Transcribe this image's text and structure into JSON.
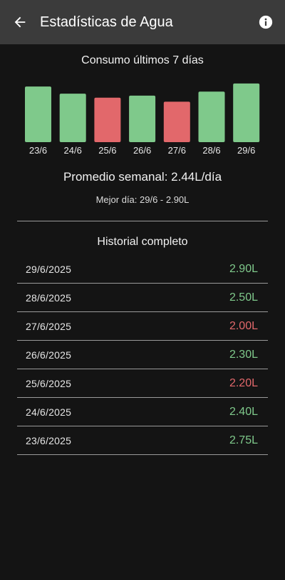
{
  "appbar": {
    "title": "Estadísticas de Agua",
    "back_icon": "arrow-left-icon",
    "info_icon": "info-icon"
  },
  "colors": {
    "good": "#7fc98b",
    "bad": "#e2686b",
    "appbar": "#3b3b3b",
    "background": "#141414"
  },
  "chart": {
    "title": "Consumo últimos 7 días"
  },
  "chart_data": {
    "type": "bar",
    "categories": [
      "23/6",
      "24/6",
      "25/6",
      "26/6",
      "27/6",
      "28/6",
      "29/6"
    ],
    "values": [
      2.75,
      2.4,
      2.2,
      2.3,
      2.0,
      2.5,
      2.9
    ],
    "status": [
      "good",
      "good",
      "bad",
      "good",
      "bad",
      "good",
      "good"
    ],
    "title": "Consumo últimos 7 días",
    "xlabel": "",
    "ylabel": "",
    "unit": "L",
    "grid": false
  },
  "summary": {
    "average": "Promedio semanal: 2.44L/día",
    "best_day": "Mejor día: 29/6 - 2.90L"
  },
  "history": {
    "title": "Historial completo",
    "rows": [
      {
        "date": "29/6/2025",
        "value": "2.90L",
        "status": "good"
      },
      {
        "date": "28/6/2025",
        "value": "2.50L",
        "status": "good"
      },
      {
        "date": "27/6/2025",
        "value": "2.00L",
        "status": "bad"
      },
      {
        "date": "26/6/2025",
        "value": "2.30L",
        "status": "good"
      },
      {
        "date": "25/6/2025",
        "value": "2.20L",
        "status": "bad"
      },
      {
        "date": "24/6/2025",
        "value": "2.40L",
        "status": "good"
      },
      {
        "date": "23/6/2025",
        "value": "2.75L",
        "status": "good"
      }
    ]
  }
}
